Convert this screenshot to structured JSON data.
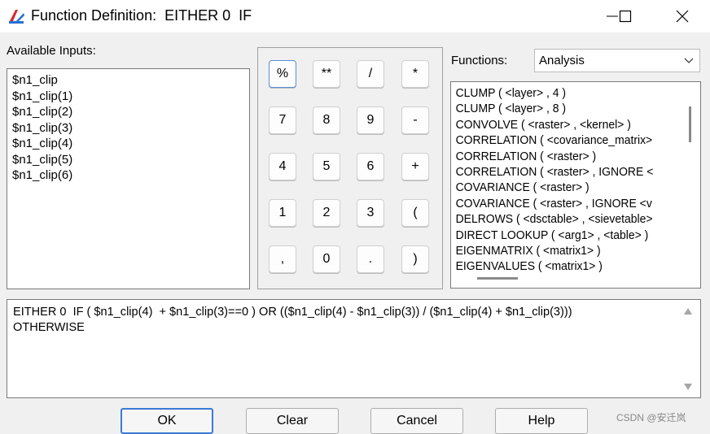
{
  "window": {
    "title": "Function Definition:  EITHER 0  IF",
    "icon": "function-definition-app-icon",
    "controls": [
      "minimize-icon",
      "maximize-icon",
      "close-icon"
    ]
  },
  "available_inputs": {
    "label": "Available Inputs:",
    "items": [
      "$n1_clip",
      "$n1_clip(1)",
      "$n1_clip(2)",
      "$n1_clip(3)",
      "$n1_clip(4)",
      "$n1_clip(5)",
      "$n1_clip(6)"
    ]
  },
  "keypad": {
    "keys": [
      "%",
      "**",
      "/",
      "*",
      "7",
      "8",
      "9",
      "-",
      "4",
      "5",
      "6",
      "+",
      "1",
      "2",
      "3",
      "(",
      ",",
      "0",
      ".",
      ")"
    ]
  },
  "functions": {
    "label": "Functions:",
    "category_selected": "Analysis",
    "items": [
      "CLUMP ( <layer> , 4 )",
      "CLUMP ( <layer> , 8 )",
      "CONVOLVE ( <raster> , <kernel> )",
      "CORRELATION ( <covariance_matrix>",
      "CORRELATION ( <raster> )",
      "CORRELATION ( <raster> , IGNORE <",
      "COVARIANCE ( <raster> )",
      "COVARIANCE ( <raster> , IGNORE <v",
      "DELROWS ( <dsctable> , <sievetable>",
      "DIRECT LOOKUP ( <arg1> , <table> )",
      "EIGENMATRIX ( <matrix1> )",
      "EIGENVALUES ( <matrix1> )"
    ]
  },
  "expression": {
    "text": "EITHER 0  IF ( $n1_clip(4)  + $n1_clip(3)==0 ) OR (($n1_clip(4) - $n1_clip(3)) / ($n1_clip(4) + $n1_clip(3)))\nOTHERWISE"
  },
  "buttons": {
    "ok": "OK",
    "clear": "Clear",
    "cancel": "Cancel",
    "help": "Help"
  },
  "watermark": "CSDN @安迁岚",
  "colors": {
    "dialog_bg": "#f0f0f0",
    "focus_border": "#3a7ad6",
    "icon_red": "#d8262d",
    "icon_blue": "#2b6fd1"
  }
}
